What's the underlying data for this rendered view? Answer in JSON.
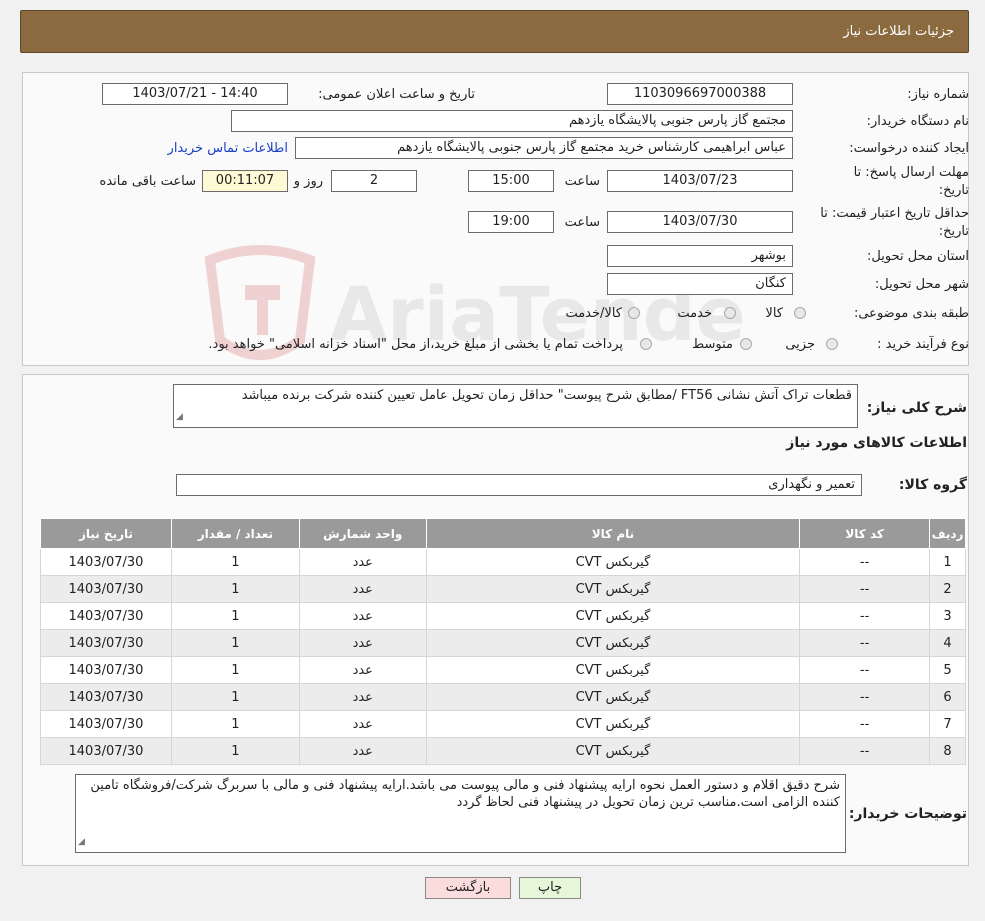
{
  "header": {
    "title": "جزئیات اطلاعات نیاز"
  },
  "form": {
    "need_number_label": "شماره نیاز:",
    "need_number": "1103096697000388",
    "announce_label": "تاریخ و ساعت اعلان عمومی:",
    "announce_value": "1403/07/21 - 14:40",
    "buyer_org_label": "نام دستگاه خریدار:",
    "buyer_org": "مجتمع گاز پارس جنوبی  پالایشگاه یازدهم",
    "creator_label": "ایجاد کننده درخواست:",
    "creator": "عباس ابراهیمی کارشناس خرید مجتمع گاز پارس جنوبی  پالایشگاه یازدهم",
    "contact_link": "اطلاعات تماس خریدار",
    "deadline_label_1": "مهلت ارسال پاسخ: تا",
    "deadline_label_2": "تاریخ:",
    "deadline_date": "1403/07/23",
    "time_label": "ساعت",
    "deadline_time": "15:00",
    "days_value": "2",
    "days_label": "روز و",
    "remaining_value": "00:11:07",
    "remaining_label": "ساعت باقی مانده",
    "validity_label_1": "حداقل تاریخ اعتبار قیمت: تا",
    "validity_label_2": "تاریخ:",
    "validity_date": "1403/07/30",
    "validity_time": "19:00",
    "province_label": "استان محل تحویل:",
    "province": "بوشهر",
    "city_label": "شهر محل تحویل:",
    "city": "کنگان",
    "category_label": "طبقه بندی موضوعی:",
    "category_options": [
      "کالا",
      "خدمت",
      "کالا/خدمت"
    ],
    "process_label": "نوع فرآیند خرید :",
    "process_options": [
      "جزیی",
      "متوسط"
    ],
    "process_note": "پرداخت تمام یا بخشی از مبلغ خرید،از محل \"اسناد خزانه اسلامی\" خواهد بود."
  },
  "summary": {
    "label": "شرح کلی نیاز:",
    "text": "قطعات تراک آتش نشانی FT56 /مطابق شرح پیوست\" حداقل زمان تحویل عامل تعیین کننده شرکت برنده میباشد"
  },
  "goods": {
    "section_title": "اطلاعات کالاهای مورد نیاز",
    "group_label": "گروه کالا:",
    "group_value": "تعمیر و نگهداری",
    "columns": [
      "ردیف",
      "کد کالا",
      "نام کالا",
      "واحد شمارش",
      "تعداد / مقدار",
      "تاریخ نیاز"
    ],
    "rows": [
      [
        "1",
        "--",
        "گیربکس CVT",
        "عدد",
        "1",
        "1403/07/30"
      ],
      [
        "2",
        "--",
        "گیربکس CVT",
        "عدد",
        "1",
        "1403/07/30"
      ],
      [
        "3",
        "--",
        "گیربکس CVT",
        "عدد",
        "1",
        "1403/07/30"
      ],
      [
        "4",
        "--",
        "گیربکس CVT",
        "عدد",
        "1",
        "1403/07/30"
      ],
      [
        "5",
        "--",
        "گیربکس CVT",
        "عدد",
        "1",
        "1403/07/30"
      ],
      [
        "6",
        "--",
        "گیربکس CVT",
        "عدد",
        "1",
        "1403/07/30"
      ],
      [
        "7",
        "--",
        "گیربکس CVT",
        "عدد",
        "1",
        "1403/07/30"
      ],
      [
        "8",
        "--",
        "گیربکس CVT",
        "عدد",
        "1",
        "1403/07/30"
      ]
    ]
  },
  "notes": {
    "label": "توضیحات خریدار:",
    "text": "شرح دقیق اقلام و دستور العمل نحوه ارایه پیشنهاد فنی و مالی پیوست می باشد.ارایه پیشنهاد فنی و مالی با سربرگ شرکت/فروشگاه تامین کننده الزامی است.مناسب ترین زمان تحویل در پیشنهاد فنی لحاظ گردد"
  },
  "buttons": {
    "print": "چاپ",
    "back": "بازگشت"
  },
  "watermark": {
    "text": "AriaTender.neT"
  },
  "colors": {
    "header": "#8b6a3f",
    "table_header": "#9a9a9a",
    "link": "#1a3fc7",
    "print_btn": "#e6f7d9",
    "back_btn": "#fbdcdc"
  }
}
